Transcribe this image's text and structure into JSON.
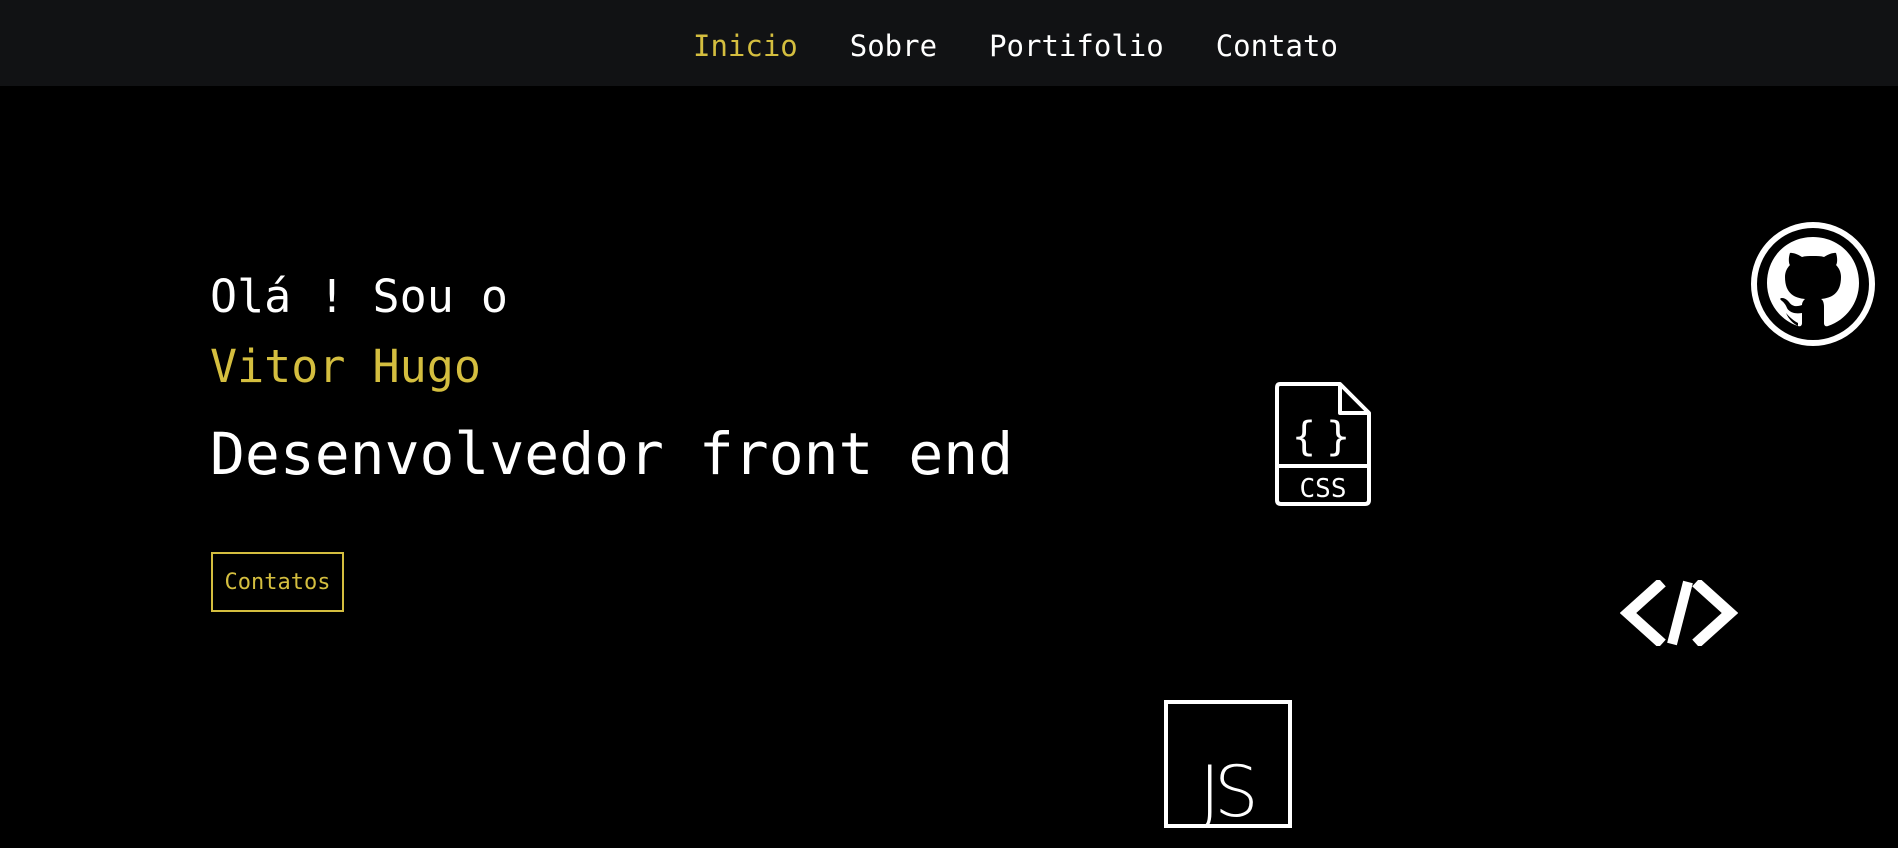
{
  "nav": {
    "items": [
      {
        "label": "Inicio",
        "active": true
      },
      {
        "label": "Sobre",
        "active": false
      },
      {
        "label": "Portifolio",
        "active": false
      },
      {
        "label": "Contato",
        "active": false
      }
    ]
  },
  "hero": {
    "greeting": "Olá ! Sou o",
    "name": "Vitor Hugo",
    "role": "Desenvolvedor front end",
    "button_label": "Contatos"
  },
  "icons": {
    "css_label": "CSS",
    "js_label": "JS",
    "list": [
      "github-icon",
      "css-file-icon",
      "code-tag-icon",
      "js-icon"
    ]
  },
  "colors": {
    "accent": "#d4be3f",
    "background": "#000000",
    "navbar": "#111214",
    "text": "#ffffff"
  }
}
